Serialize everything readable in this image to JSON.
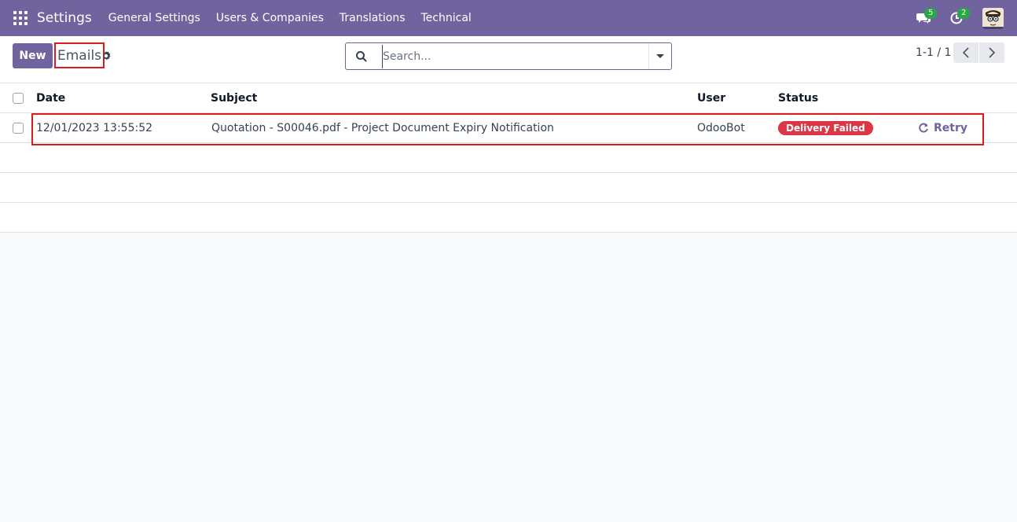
{
  "navbar": {
    "brand": "Settings",
    "menu": [
      "General Settings",
      "Users & Companies",
      "Translations",
      "Technical"
    ],
    "messages_count": "5",
    "activities_count": "2",
    "color": "#71639e"
  },
  "control": {
    "new_label": "New",
    "breadcrumb": "Emails",
    "search_placeholder": "Search...",
    "pager": "1-1 / 1"
  },
  "list": {
    "headers": {
      "date": "Date",
      "subject": "Subject",
      "user": "User",
      "status": "Status"
    },
    "rows": [
      {
        "date": "12/01/2023 13:55:52",
        "subject": "Quotation - S00046.pdf - Project Document Expiry Notification",
        "user": "OdooBot",
        "status": "Delivery Failed",
        "action": "Retry"
      }
    ]
  },
  "colors": {
    "accent": "#71639e",
    "danger": "#dc3545",
    "highlight": "#dc1c1c"
  }
}
